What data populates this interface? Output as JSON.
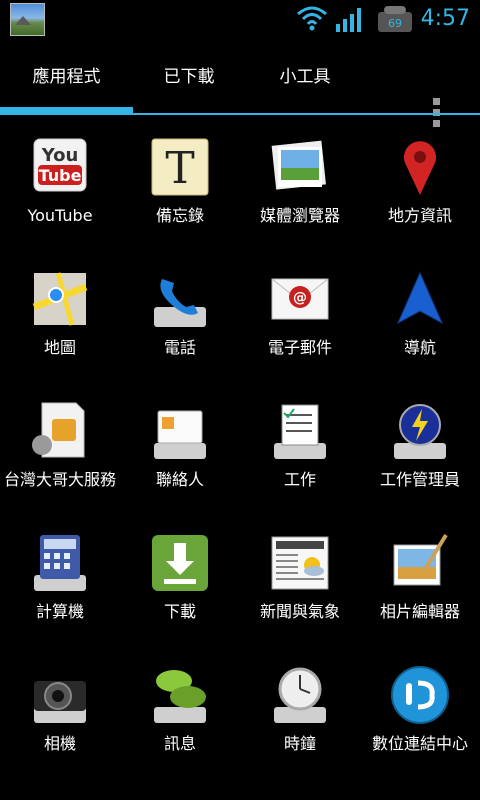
{
  "status_bar": {
    "time": "4:57"
  },
  "tabs": [
    {
      "label": "應用程式"
    },
    {
      "label": "已下載"
    },
    {
      "label": "小工具"
    }
  ],
  "apps": [
    {
      "label": "YouTube"
    },
    {
      "label": "備忘錄"
    },
    {
      "label": "媒體瀏覽器"
    },
    {
      "label": "地方資訊"
    },
    {
      "label": "地圖"
    },
    {
      "label": "電話"
    },
    {
      "label": "電子郵件"
    },
    {
      "label": "導航"
    },
    {
      "label": "台灣大哥大服務"
    },
    {
      "label": "聯絡人"
    },
    {
      "label": "工作"
    },
    {
      "label": "工作管理員"
    },
    {
      "label": "計算機"
    },
    {
      "label": "下載"
    },
    {
      "label": "新聞與氣象"
    },
    {
      "label": "相片編輯器"
    },
    {
      "label": "相機"
    },
    {
      "label": "訊息"
    },
    {
      "label": "時鐘"
    },
    {
      "label": "數位連結中心"
    }
  ],
  "icons": {
    "YouTube": "youtube-icon",
    "note": "notepad-icon",
    "gallery": "gallery-icon",
    "places": "places-icon",
    "maps": "maps-icon",
    "phone": "phone-icon",
    "email": "email-icon",
    "nav": "navigation-icon",
    "sim": "sim-card-icon",
    "contacts": "contacts-icon",
    "tasks": "tasks-icon",
    "taskmgr": "task-manager-icon",
    "calc": "calculator-icon",
    "download": "download-icon",
    "news": "news-weather-icon",
    "photoedit": "photo-editor-icon",
    "camera": "camera-icon",
    "messages": "messages-icon",
    "clock": "clock-icon",
    "dlna": "digital-hub-icon"
  },
  "colors": {
    "accent": "#33b5e5",
    "background": "#000000"
  }
}
